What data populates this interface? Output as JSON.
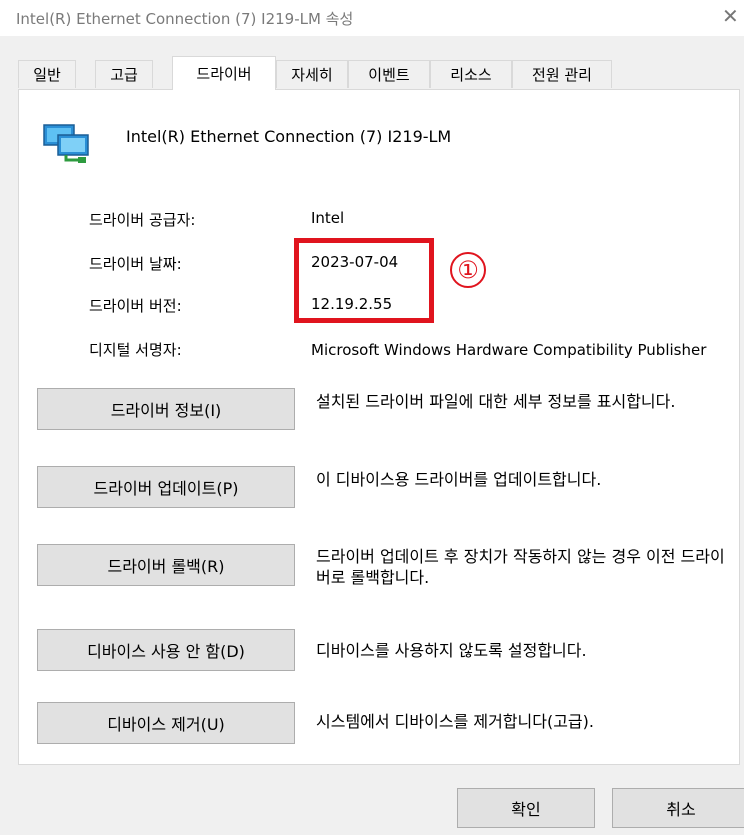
{
  "window": {
    "title": "Intel(R) Ethernet Connection (7) I219-LM 속성",
    "close_glyph": "✕"
  },
  "tabs": [
    {
      "label": "일반",
      "active": false
    },
    {
      "label": "고급",
      "active": false
    },
    {
      "label": "드라이버",
      "active": true
    },
    {
      "label": "자세히",
      "active": false
    },
    {
      "label": "이벤트",
      "active": false
    },
    {
      "label": "리소스",
      "active": false
    },
    {
      "label": "전원 관리",
      "active": false
    }
  ],
  "device": {
    "name": "Intel(R) Ethernet Connection (7) I219-LM",
    "icon": "network-adapter-icon"
  },
  "info": [
    {
      "label": "드라이버 공급자:",
      "value": "Intel"
    },
    {
      "label": "드라이버 날짜:",
      "value": "2023-07-04"
    },
    {
      "label": "드라이버 버전:",
      "value": "12.19.2.55"
    },
    {
      "label": "디지털 서명자:",
      "value": "Microsoft Windows Hardware Compatibility Publisher"
    }
  ],
  "annotation": {
    "number": "①",
    "color": "#e0141e"
  },
  "actions": [
    {
      "button": "드라이버 정보(I)",
      "description": "설치된 드라이버 파일에 대한 세부 정보를 표시합니다."
    },
    {
      "button": "드라이버 업데이트(P)",
      "description": "이 디바이스용 드라이버를 업데이트합니다."
    },
    {
      "button": "드라이버 롤백(R)",
      "description": "드라이버 업데이트 후 장치가 작동하지 않는 경우 이전 드라이버로 롤백합니다."
    },
    {
      "button": "디바이스 사용 안 함(D)",
      "description": "디바이스를 사용하지 않도록 설정합니다."
    },
    {
      "button": "디바이스 제거(U)",
      "description": "시스템에서 디바이스를 제거합니다(고급)."
    }
  ],
  "footer": {
    "ok": "확인",
    "cancel": "취소"
  }
}
